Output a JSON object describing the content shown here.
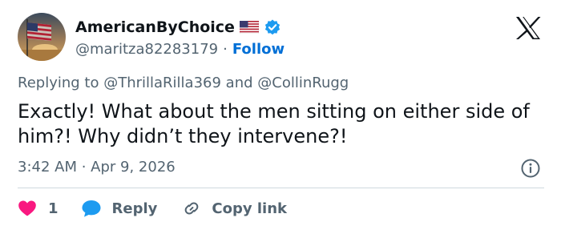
{
  "author": {
    "display_name": "AmericanByChoice",
    "handle": "@maritza82283179",
    "separator": "·",
    "follow_label": "Follow"
  },
  "reply_to": {
    "prefix": "Replying to ",
    "mention_1": "@ThrillaRilla369",
    "conjunction": " and ",
    "mention_2": "@CollinRugg"
  },
  "tweet": {
    "text": "Exactly! What about the men sitting on either side of him?! Why didn’t they intervene?!",
    "timestamp": "3:42 AM · Apr 9, 2026"
  },
  "actions": {
    "like_count": "1",
    "reply_label": "Reply",
    "copy_label": "Copy link"
  },
  "icons": {
    "logo": "x-logo-icon",
    "flag": "us-flag-icon",
    "verified": "verified-badge-icon",
    "info": "info-icon",
    "like": "heart-icon",
    "reply": "speech-bubble-icon",
    "copy": "link-icon"
  },
  "colors": {
    "text": "#0f1419",
    "secondary": "#536471",
    "link": "#006fd6",
    "verified": "#1d9bf0",
    "like": "#f91880",
    "reply": "#1d9bf0",
    "divider": "#cfd9de"
  }
}
